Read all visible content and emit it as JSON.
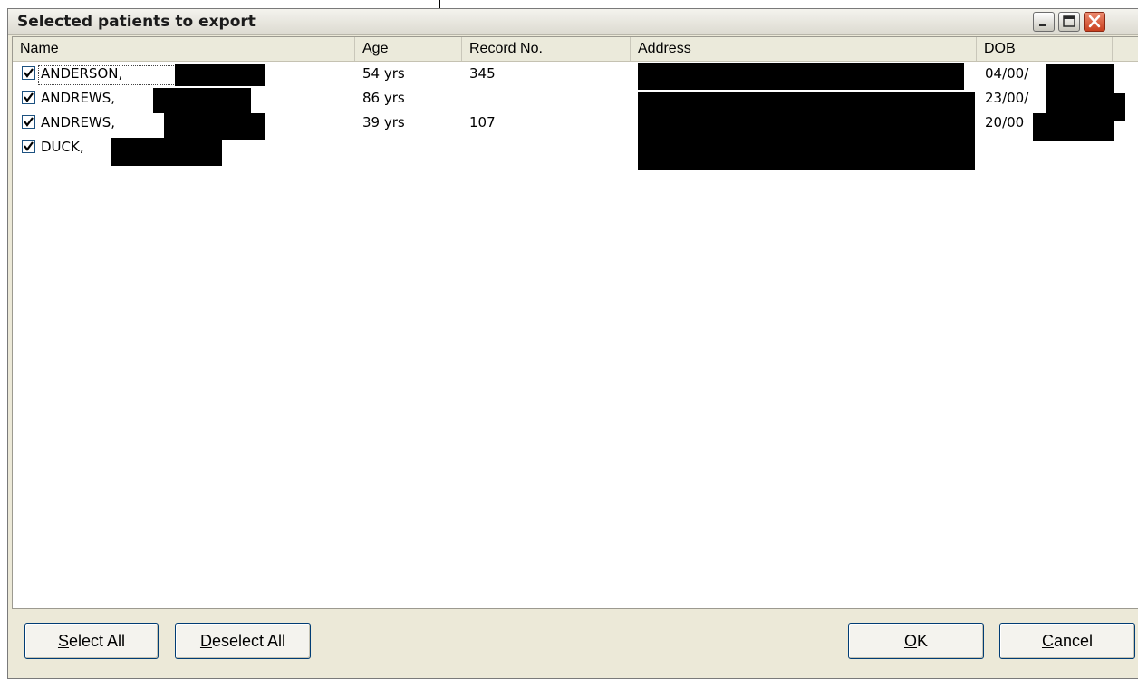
{
  "window": {
    "title": "Selected patients to export"
  },
  "columns": [
    "Name",
    "Age",
    "Record No.",
    "Address",
    "DOB"
  ],
  "rows": [
    {
      "name": "ANDERSON,",
      "age": "54 yrs",
      "record": "345",
      "dob": "04/00/",
      "checked": true
    },
    {
      "name": "ANDREWS,",
      "age": "86 yrs",
      "record": "",
      "dob": "23/00/",
      "checked": true
    },
    {
      "name": "ANDREWS,",
      "age": "39 yrs",
      "record": "107",
      "dob": "20/00",
      "checked": true
    },
    {
      "name": "DUCK,",
      "age": "",
      "record": "",
      "dob": "",
      "checked": true
    }
  ],
  "buttons": {
    "select_all_key": "S",
    "select_all_rest": "elect All",
    "deselect_all_key": "D",
    "deselect_all_rest": "eselect All",
    "ok_key": "O",
    "ok_rest": "K",
    "cancel_key": "C",
    "cancel_rest": "ancel"
  },
  "colors": {
    "title_bg": "#ece9d8",
    "close_button": "#c9401f",
    "redaction": "#000000"
  }
}
